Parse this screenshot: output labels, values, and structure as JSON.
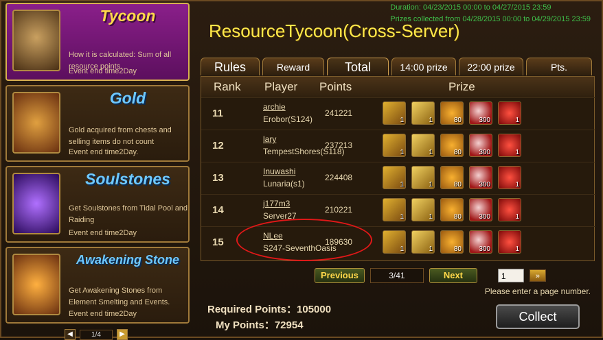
{
  "categories": [
    {
      "title": "Tycoon",
      "desc": "How it is calculated: Sum of all resource points.",
      "end": "Event end time2Day"
    },
    {
      "title": "Gold",
      "desc": "Gold acquired from chests and selling items do not count",
      "end": "Event end time2Day."
    },
    {
      "title": "Soulstones",
      "desc": "Get Soulstones from Tidal Pool and Raiding",
      "end": "Event end time2Day"
    },
    {
      "title": "Awakening Stone",
      "desc": "Get Awakening Stones from Element Smelting and Events.",
      "end": "Event end time2Day"
    }
  ],
  "left_pager": {
    "prev": "◀",
    "page": "1/4",
    "next": "▶"
  },
  "duration": "Duration: 04/23/2015 00:00 to 04/27/2015 23:59",
  "prizes_collected": "Prizes collected from 04/28/2015 00:00 to 04/29/2015 23:59",
  "main_title": "ResourceTycoon(Cross-Server)",
  "tabs": [
    "Rules",
    "Reward List",
    "Total",
    "14:00 prize",
    "22:00 prize",
    "Pts. Reward"
  ],
  "headers": {
    "rank": "Rank",
    "player": "Player",
    "points": "Points",
    "prize": "Prize"
  },
  "rows": [
    {
      "rank": "11",
      "name": "archie",
      "server": "Erobor(S124)",
      "points": "241221"
    },
    {
      "rank": "12",
      "name": "lary",
      "server": "TempestShores(S118)",
      "points": "237213"
    },
    {
      "rank": "13",
      "name": "Inuwashi",
      "server": "Lunaria(s1)",
      "points": "224408"
    },
    {
      "rank": "14",
      "name": "j177m3",
      "server": "Server27",
      "points": "210221"
    },
    {
      "rank": "15",
      "name": "NLee",
      "server": "S247-SeventhOasis",
      "points": "189630"
    }
  ],
  "prize_qty": [
    "1",
    "1",
    "80",
    "300",
    "1"
  ],
  "pager": {
    "previous": "Previous",
    "page": "3/41",
    "next": "Next",
    "input": "1",
    "go": "»"
  },
  "hint": "Please enter a page number.",
  "required": "Required Points：105000",
  "mine": "My Points：72954",
  "collect": "Collect"
}
